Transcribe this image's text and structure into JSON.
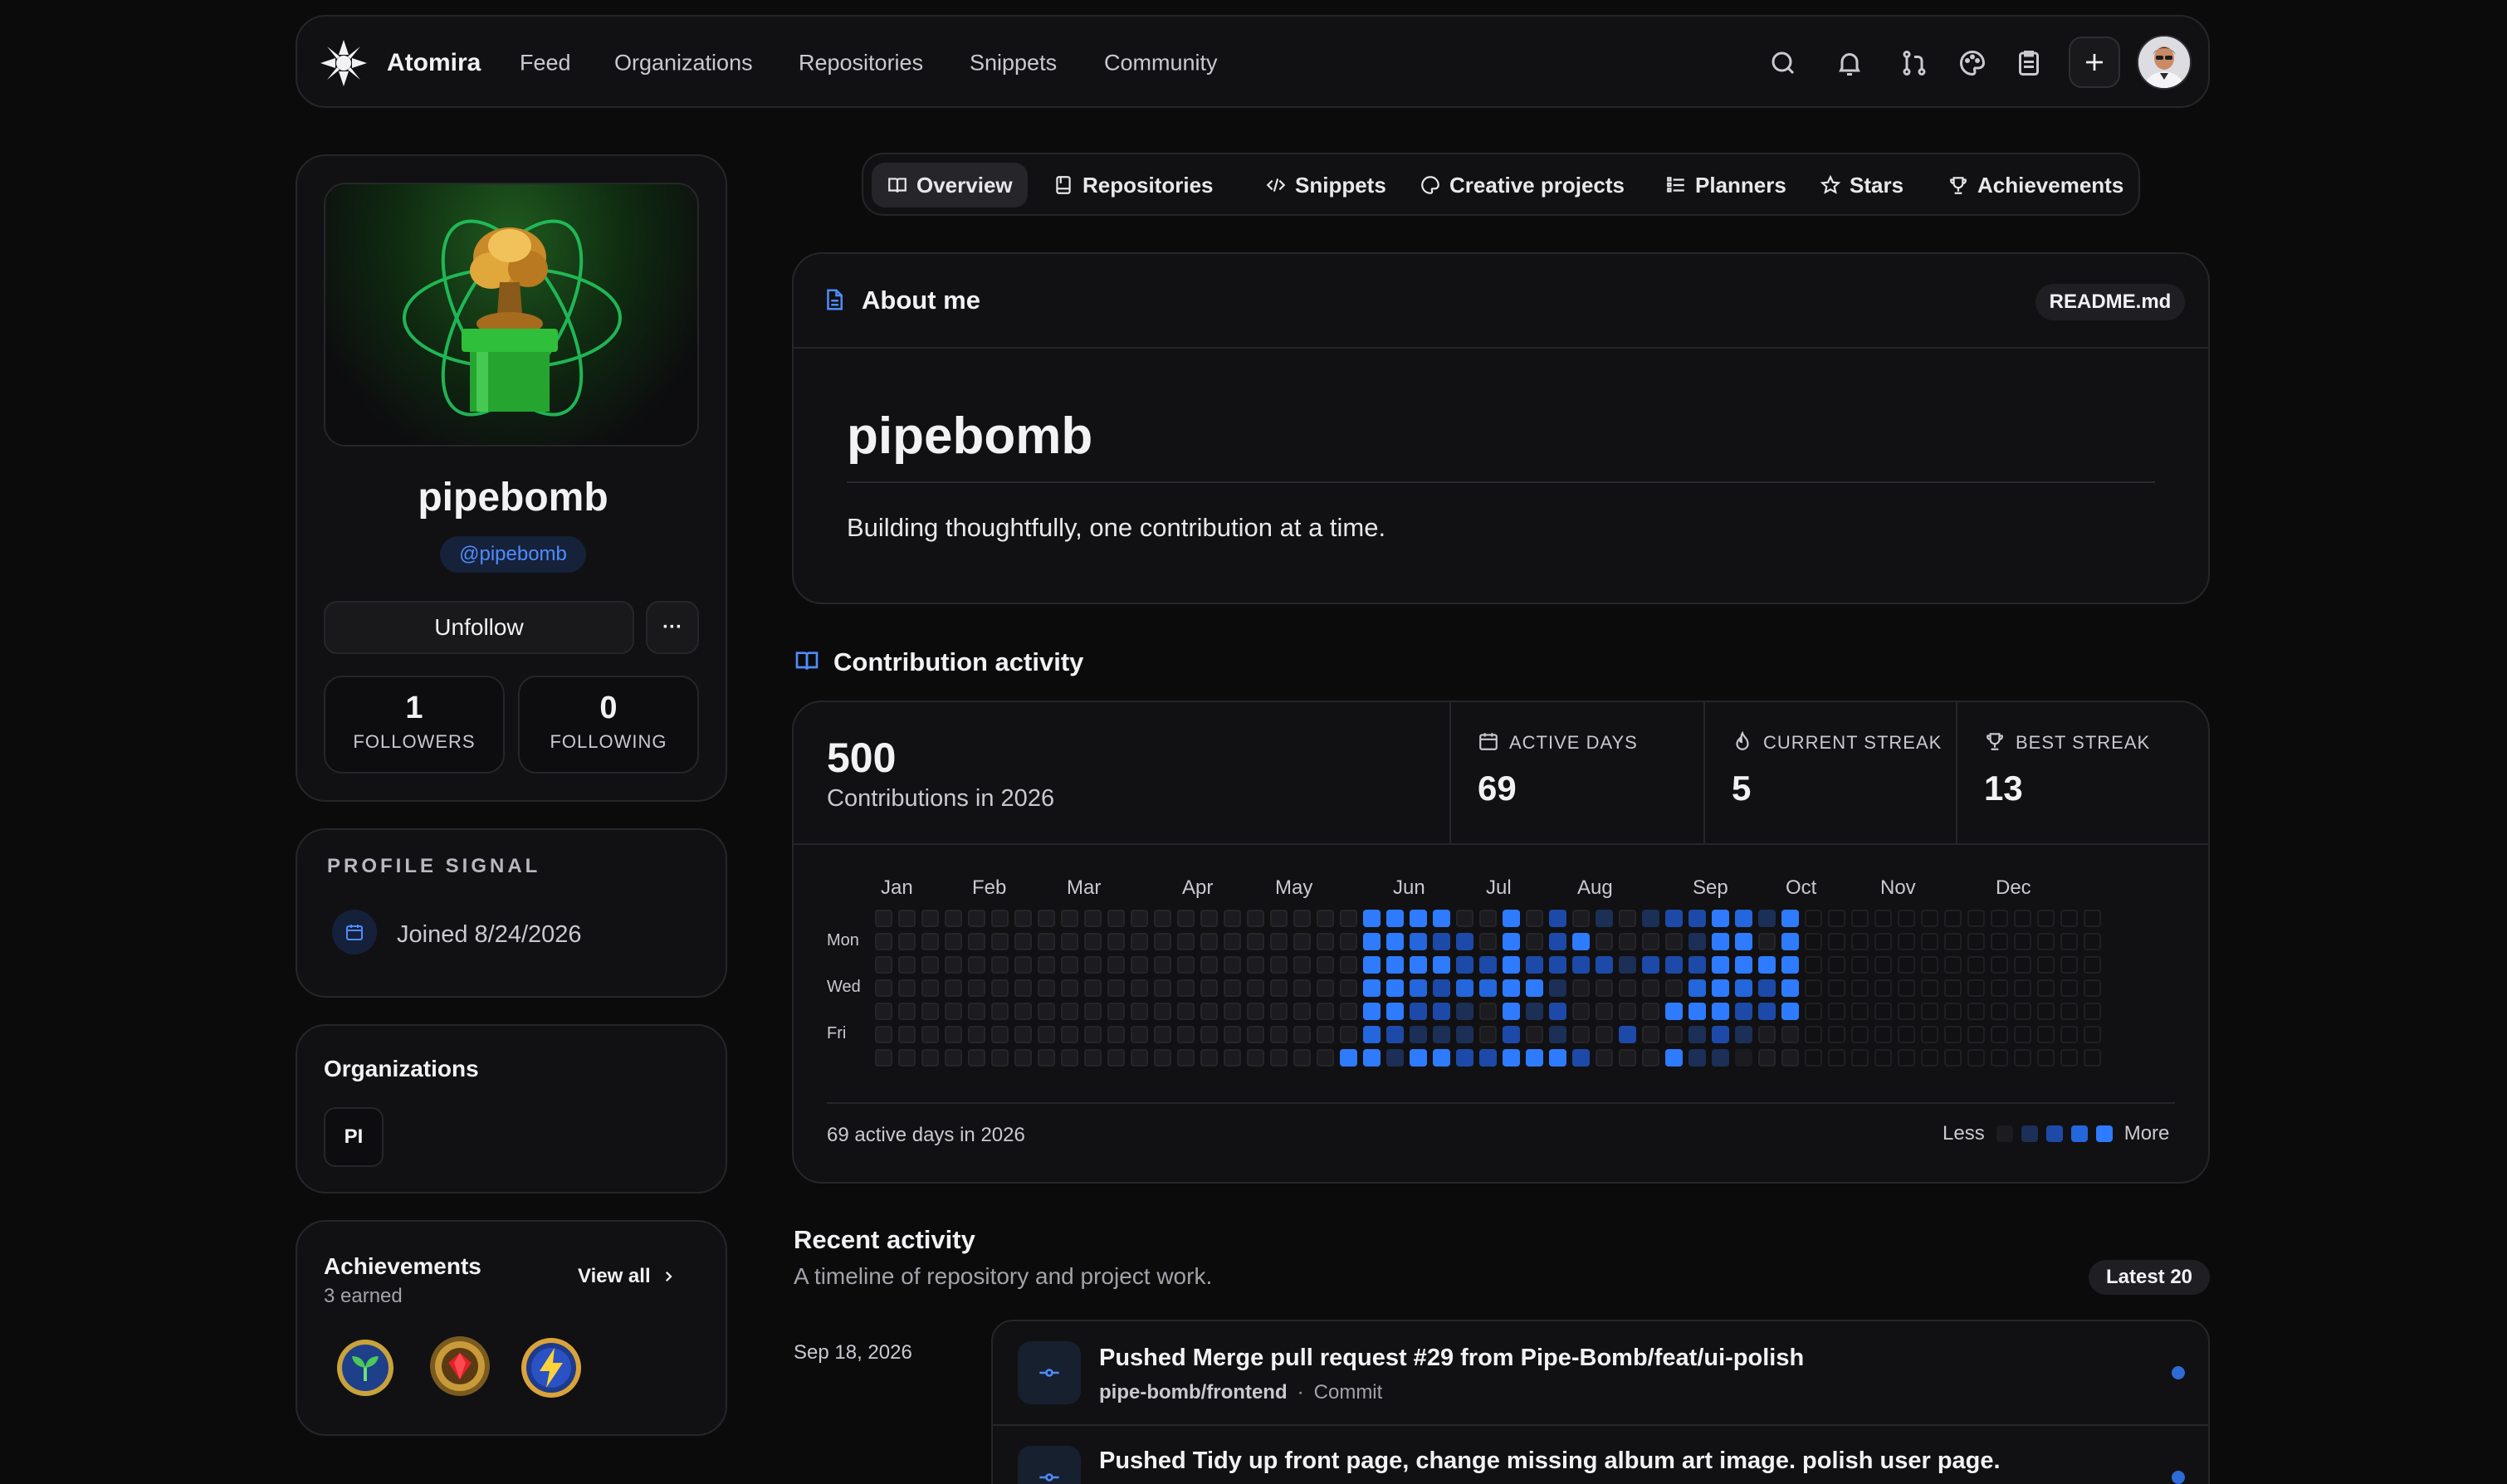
{
  "nav": {
    "brand": "Atomira",
    "links": [
      "Feed",
      "Organizations",
      "Repositories",
      "Snippets",
      "Community"
    ],
    "icons": [
      "search-icon",
      "bell-icon",
      "pull-request-icon",
      "palette-icon",
      "clipboard-icon",
      "plus-icon"
    ]
  },
  "tabs": [
    {
      "label": "Overview",
      "icon": "book-open-icon"
    },
    {
      "label": "Repositories",
      "icon": "repo-icon"
    },
    {
      "label": "Snippets",
      "icon": "code-icon"
    },
    {
      "label": "Creative projects",
      "icon": "palette-icon"
    },
    {
      "label": "Planners",
      "icon": "list-icon"
    },
    {
      "label": "Stars",
      "icon": "star-icon"
    },
    {
      "label": "Achievements",
      "icon": "trophy-icon"
    }
  ],
  "profile": {
    "name": "pipebomb",
    "handle": "@pipebomb",
    "follow_label": "Unfollow",
    "more_label": "···",
    "followers": {
      "count": "1",
      "label": "FOLLOWERS"
    },
    "following": {
      "count": "0",
      "label": "FOLLOWING"
    }
  },
  "signal": {
    "title": "PROFILE SIGNAL",
    "joined": "Joined 8/24/2026"
  },
  "organizations": {
    "title": "Organizations",
    "items": [
      "PI"
    ]
  },
  "achievements": {
    "title": "Achievements",
    "earned": "3 earned",
    "view_all": "View all"
  },
  "about": {
    "title": "About me",
    "file": "README.md",
    "heading": "pipebomb",
    "text": "Building thoughtfully, one contribution at a time."
  },
  "contrib": {
    "title": "Contribution activity",
    "total": "500",
    "total_label": "Contributions in 2026",
    "active_days_label": "ACTIVE DAYS",
    "active_days": "69",
    "current_streak_label": "CURRENT STREAK",
    "current_streak": "5",
    "best_streak_label": "BEST STREAK",
    "best_streak": "13",
    "months": [
      "Jan",
      "Feb",
      "Mar",
      "Apr",
      "May",
      "Jun",
      "Jul",
      "Aug",
      "Sep",
      "Oct",
      "Nov",
      "Dec"
    ],
    "days": [
      "Mon",
      "Wed",
      "Fri"
    ],
    "footer": "69 active days in 2026",
    "legend_less": "Less",
    "legend_more": "More",
    "colors": [
      "#1c1c20",
      "#1b2f57",
      "#1d4aa8",
      "#2466db",
      "#2e7bff"
    ]
  },
  "recent": {
    "title": "Recent activity",
    "subtitle": "A timeline of repository and project work.",
    "badge": "Latest 20",
    "date": "Sep 18, 2026",
    "items": [
      {
        "title": "Pushed Merge pull request #29 from Pipe-Bomb/feat/ui-polish",
        "repo": "pipe-bomb/frontend",
        "kind": "Commit"
      },
      {
        "title": "Pushed Tidy up front page, change missing album art image. polish user page.",
        "repo": "",
        "kind": ""
      }
    ]
  }
}
